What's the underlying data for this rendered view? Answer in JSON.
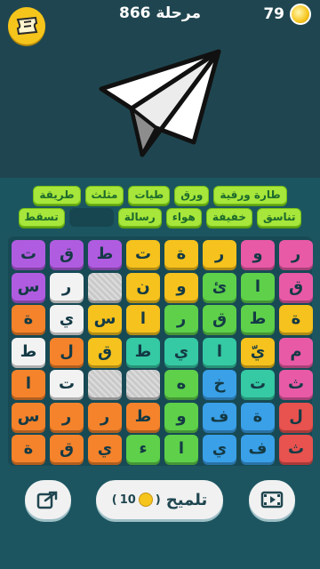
{
  "header": {
    "level_label": "مرحلة",
    "level_number": "866",
    "coins": "79"
  },
  "answers": {
    "row1": [
      "طارة ورقية",
      "ورق",
      "طيات",
      "مثلث",
      "طريقة"
    ],
    "row2": [
      "تناسق",
      "خفيفة",
      "هواء",
      "رسالة",
      "",
      "تسقط"
    ]
  },
  "grid": {
    "rows": [
      [
        "ر",
        "و",
        "ر",
        "ة",
        "ت",
        "ط",
        "ق",
        "ت"
      ],
      [
        "ق",
        "ا",
        "ئ",
        "و",
        "ن",
        "",
        "ر",
        "س"
      ],
      [
        "ة",
        "ط",
        "ق",
        "ر",
        "ا",
        "س",
        "ي",
        "ة"
      ],
      [
        "م",
        "يّ",
        "ا",
        "ي",
        "ط",
        "ق",
        "ل",
        "ط"
      ],
      [
        "ث",
        "ت",
        "خ",
        "ه",
        "",
        "",
        "ت",
        "ا"
      ],
      [
        "ل",
        "ة",
        "ف",
        "و",
        "ط",
        "ر",
        "ر",
        "س"
      ],
      [
        "ث",
        "ف",
        "ي",
        "ا",
        "ء",
        "ي",
        "ق",
        "ة"
      ]
    ],
    "colors": [
      [
        "#e85aa6",
        "#e85aa6",
        "#f6c21d",
        "#f6c21d",
        "#f6c21d",
        "#b05ce0",
        "#b05ce0",
        "#b05ce0"
      ],
      [
        "#e85aa6",
        "#5ed04a",
        "#5ed04a",
        "#f6c21d",
        "#f6c21d",
        "#c9c9c9",
        "#f2f2f2",
        "#b05ce0"
      ],
      [
        "#f6c21d",
        "#5ed04a",
        "#5ed04a",
        "#5ed04a",
        "#f6c21d",
        "#f6c21d",
        "#f2f2f2",
        "#f5832b"
      ],
      [
        "#e85aa6",
        "#f6c21d",
        "#35c9a4",
        "#35c9a4",
        "#35c9a4",
        "#f6c21d",
        "#f5832b",
        "#f2f2f2"
      ],
      [
        "#e85aa6",
        "#35c9a4",
        "#3aa0e8",
        "#5ed04a",
        "#c9c9c9",
        "#c9c9c9",
        "#f2f2f2",
        "#f5832b"
      ],
      [
        "#e8524f",
        "#3aa0e8",
        "#3aa0e8",
        "#5ed04a",
        "#f5832b",
        "#f5832b",
        "#f5832b",
        "#f5832b"
      ],
      [
        "#e8524f",
        "#3aa0e8",
        "#3aa0e8",
        "#5ed04a",
        "#5ed04a",
        "#f5832b",
        "#f5832b",
        "#f5832b"
      ]
    ]
  },
  "hint": {
    "label": "تلميح",
    "cost": "10"
  },
  "icons": {
    "menu": "ticket-icon",
    "coin": "coin-icon",
    "share": "share-icon",
    "video": "video-icon",
    "puzzle": "paper-plane-image"
  }
}
